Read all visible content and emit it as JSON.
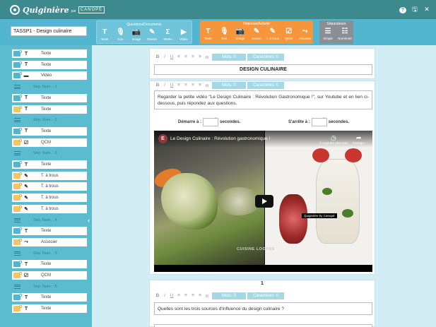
{
  "titlebar": {
    "brand": "Quiginière",
    "by": "par",
    "publisher": "CANOPÉ",
    "controls": {
      "help": "?",
      "save": "🖫",
      "close": "✕"
    }
  },
  "toolbar": {
    "doc_title": "TASSP1 - Design culinaire",
    "questions_group": {
      "title": "Questions/Documents",
      "tools": [
        {
          "icon": "T",
          "label": "Texte"
        },
        {
          "icon": "🎙",
          "label": "Son"
        },
        {
          "icon": "📷",
          "label": "Image"
        },
        {
          "icon": "✎",
          "label": "Dessin"
        },
        {
          "icon": "Σ",
          "label": "Maths"
        },
        {
          "icon": "▶",
          "label": "Vidéo"
        }
      ]
    },
    "answers_group": {
      "title": "Réponse/Activité",
      "tools": [
        {
          "icon": "T",
          "label": "Texte"
        },
        {
          "icon": "🎙",
          "label": "Son"
        },
        {
          "icon": "📷",
          "label": "Image"
        },
        {
          "icon": "✎",
          "label": "Dessin"
        },
        {
          "icon": "✎",
          "label": "T. à trous"
        },
        {
          "icon": "☑",
          "label": "QCM"
        },
        {
          "icon": "⤳",
          "label": "Associer"
        }
      ]
    },
    "separators_group": {
      "title": "Séparateurs",
      "tools": [
        {
          "icon": "☰",
          "label": "Simple"
        },
        {
          "icon": "☷",
          "label": "Numéroté"
        }
      ]
    }
  },
  "sidebar": {
    "items": [
      {
        "kind": "q",
        "icon": "T",
        "label": "Texte"
      },
      {
        "kind": "q",
        "icon": "T",
        "label": "Texte"
      },
      {
        "kind": "q",
        "icon": "▬",
        "label": "Vidéo"
      },
      {
        "kind": "sep",
        "label": "Sép. Num. : 1"
      },
      {
        "kind": "q",
        "icon": "T",
        "label": "Texte"
      },
      {
        "kind": "a",
        "icon": "T",
        "label": "Texte"
      },
      {
        "kind": "sep",
        "label": "Sép. Num. : 2"
      },
      {
        "kind": "q",
        "icon": "T",
        "label": "Texte"
      },
      {
        "kind": "a",
        "icon": "☑",
        "label": "QCM"
      },
      {
        "kind": "sep",
        "label": "Sép. Num. : 3"
      },
      {
        "kind": "q",
        "icon": "T",
        "label": "Texte"
      },
      {
        "kind": "a",
        "icon": "✎",
        "label": "T. à trous"
      },
      {
        "kind": "a",
        "icon": "✎",
        "label": "T. à trous"
      },
      {
        "kind": "a",
        "icon": "✎",
        "label": "T. à trous"
      },
      {
        "kind": "a",
        "icon": "✎",
        "label": "T. à trous"
      },
      {
        "kind": "sep",
        "label": "Sép. Num. : 4"
      },
      {
        "kind": "q",
        "icon": "T",
        "label": "Texte"
      },
      {
        "kind": "a",
        "icon": "⤳",
        "label": "Associer"
      },
      {
        "kind": "sep",
        "label": "Sép. Num. : 5"
      },
      {
        "kind": "q",
        "icon": "T",
        "label": "Texte"
      },
      {
        "kind": "a",
        "icon": "☑",
        "label": "QCM"
      },
      {
        "kind": "sep",
        "label": "Sép. Num. : 6"
      },
      {
        "kind": "q",
        "icon": "T",
        "label": "Texte"
      },
      {
        "kind": "a",
        "icon": "T",
        "label": "Texte"
      }
    ],
    "collapse": "‹"
  },
  "format_bar": {
    "bold": "B",
    "italic": "I",
    "underline": "U",
    "align_left": "≡",
    "align_center": "≡",
    "align_right": "≡",
    "justify": "≡",
    "link": "⊖",
    "words": "Mots: 0",
    "chars": "Caractères: 0"
  },
  "card1": {
    "title": "DESIGN CULINAIRE"
  },
  "card2": {
    "text": "Regarder la petite vidéo \"Le Design Culinaire : Révolution Gastronomique !\", sur Youtube et en lien ci-dessous, puis répondez aux questions.",
    "start_label": "Démarre à :",
    "start_unit": "secondes.",
    "stop_label": "S'arrête à :",
    "stop_unit": "secondes.",
    "video": {
      "channel_initial": "E",
      "title": "Le Design Culinaire : Révolution gastronomique !",
      "watch_later": "À regarder plus tard",
      "share": "Partager",
      "tooltip": "Quiginière by Canopé",
      "caption": "CUISINE LOOKEE"
    }
  },
  "question1": {
    "number": "1",
    "text": "Quelles sont les trois sources d'influence du design culinaire ?"
  }
}
